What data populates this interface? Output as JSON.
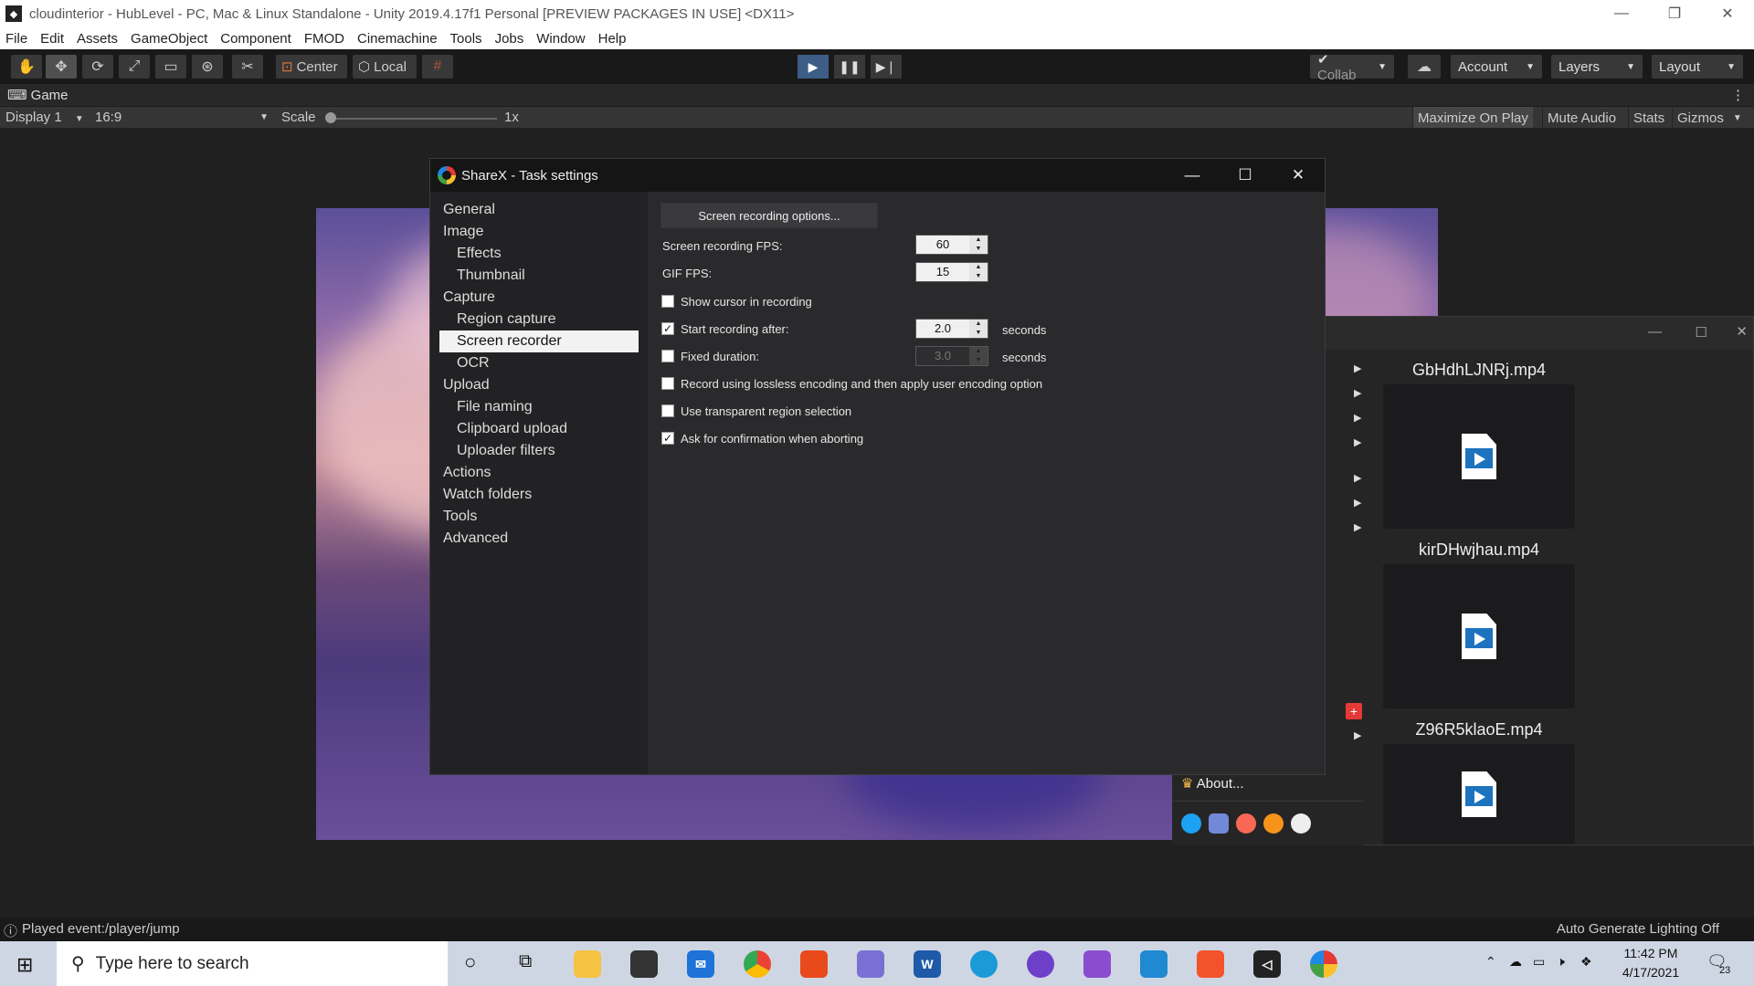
{
  "unity": {
    "title": "cloudinterior - HubLevel - PC, Mac & Linux Standalone - Unity 2019.4.17f1 Personal [PREVIEW PACKAGES IN USE] <DX11>",
    "menus": [
      "File",
      "Edit",
      "Assets",
      "GameObject",
      "Component",
      "FMOD",
      "Cinemachine",
      "Tools",
      "Jobs",
      "Window",
      "Help"
    ],
    "toolbar": {
      "center_label": "Center",
      "local_label": "Local",
      "collab_label": "Collab",
      "account_label": "Account",
      "layers_label": "Layers",
      "layout_label": "Layout"
    },
    "game_tab": "Game",
    "game_bar": {
      "display": "Display 1",
      "aspect": "16:9",
      "scale_label": "Scale",
      "scale_value": "1x",
      "maximize": "Maximize On Play",
      "mute": "Mute Audio",
      "stats": "Stats",
      "gizmos": "Gizmos"
    },
    "status_left": "Played event:/player/jump",
    "status_right": "Auto Generate Lighting Off"
  },
  "dialog": {
    "title": "ShareX - Task settings",
    "nav": [
      {
        "label": "General",
        "level": 0
      },
      {
        "label": "Image",
        "level": 0
      },
      {
        "label": "Effects",
        "level": 1
      },
      {
        "label": "Thumbnail",
        "level": 1
      },
      {
        "label": "Capture",
        "level": 0
      },
      {
        "label": "Region capture",
        "level": 1
      },
      {
        "label": "Screen recorder",
        "level": 1,
        "selected": true
      },
      {
        "label": "OCR",
        "level": 1
      },
      {
        "label": "Upload",
        "level": 0
      },
      {
        "label": "File naming",
        "level": 1
      },
      {
        "label": "Clipboard upload",
        "level": 1
      },
      {
        "label": "Uploader filters",
        "level": 1
      },
      {
        "label": "Actions",
        "level": 0
      },
      {
        "label": "Watch folders",
        "level": 0
      },
      {
        "label": "Tools",
        "level": 0
      },
      {
        "label": "Advanced",
        "level": 0
      }
    ],
    "options_button": "Screen recording options...",
    "fps_label": "Screen recording FPS:",
    "fps_value": "60",
    "gif_fps_label": "GIF FPS:",
    "gif_fps_value": "15",
    "show_cursor": {
      "label": "Show cursor in recording",
      "checked": false
    },
    "start_after": {
      "label": "Start recording after:",
      "checked": true,
      "value": "2.0",
      "unit": "seconds"
    },
    "fixed_duration": {
      "label": "Fixed duration:",
      "checked": false,
      "value": "3.0",
      "unit": "seconds"
    },
    "lossless": {
      "label": "Record using lossless encoding and then apply user encoding option",
      "checked": false
    },
    "transparent": {
      "label": "Use transparent region selection",
      "checked": false
    },
    "confirm_abort": {
      "label": "Ask for confirmation when aborting",
      "checked": true
    }
  },
  "sharex_main": {
    "files": [
      "GbHdhLJNRj.mp4",
      "kirDHwjhau.mp4",
      "Z96R5klaoE.mp4"
    ],
    "about_label": "About..."
  },
  "taskbar": {
    "search_placeholder": "Type here to search",
    "time": "11:42 PM",
    "date": "4/17/2021",
    "notifications": "23"
  },
  "colors": {
    "unity_dark": "#282828",
    "play_active": "#3d5d86",
    "taskbar": "#cfd6e3",
    "sharex_bg": "#2a2a2c"
  }
}
